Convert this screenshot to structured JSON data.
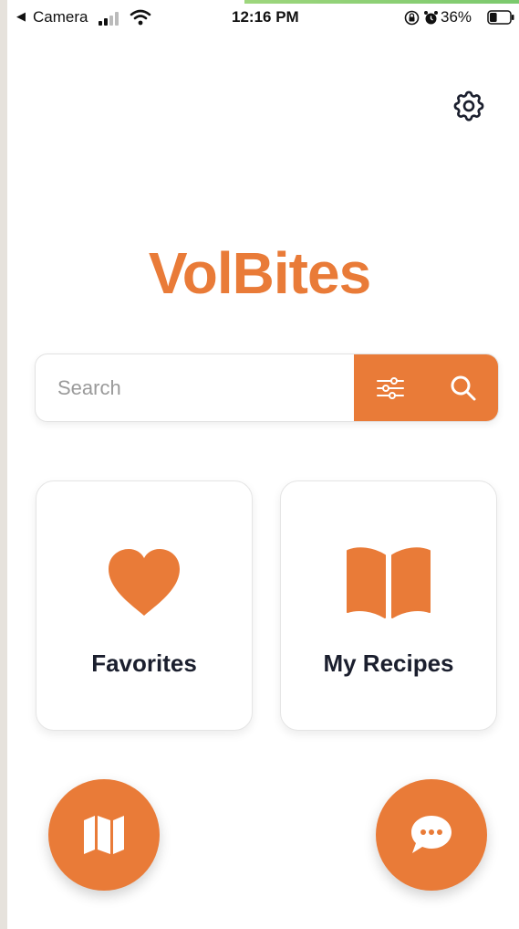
{
  "status_bar": {
    "back_arrow": "◀",
    "back_app": "Camera",
    "time": "12:16 PM",
    "battery_percent": "36%",
    "battery_level": 0.36,
    "icons": [
      "signal-icon",
      "wifi-icon",
      "orientation-lock-icon",
      "alarm-icon",
      "battery-icon"
    ]
  },
  "header": {
    "settings_icon": "gear-icon"
  },
  "app": {
    "title": "VolBites",
    "accent_color": "#e97b38",
    "text_color": "#1b1f2e"
  },
  "search": {
    "placeholder": "Search",
    "value": "",
    "filter_icon": "sliders-icon",
    "search_icon": "magnifier-icon"
  },
  "cards": [
    {
      "label": "Favorites",
      "icon": "heart-icon"
    },
    {
      "label": "My Recipes",
      "icon": "open-book-icon"
    }
  ],
  "fabs": [
    {
      "icon": "map-icon"
    },
    {
      "icon": "chat-bubble-icon"
    }
  ]
}
